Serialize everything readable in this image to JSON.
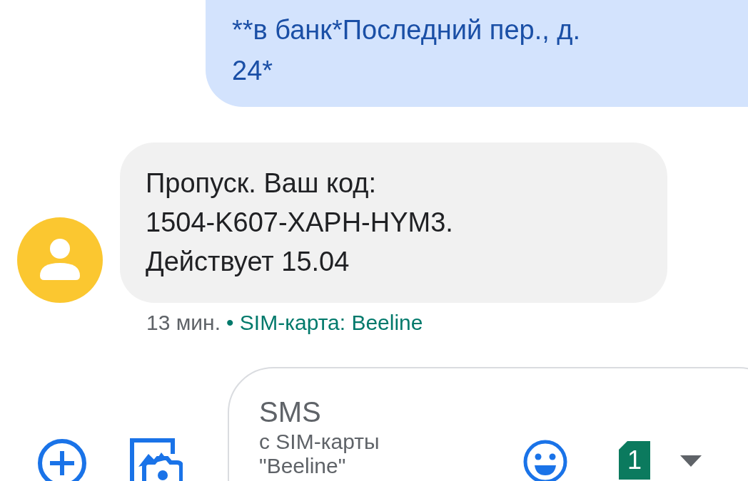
{
  "messages": [
    {
      "kind": "outgoing",
      "lines": [
        "**в банк*Последний пер., д.",
        "24*"
      ]
    },
    {
      "kind": "incoming",
      "lines": [
        "Пропуск. Ваш код:",
        "1504-K607-XAPH-HYM3.",
        "Действует 15.04"
      ],
      "time": "13 мин.",
      "sim": "• SIM-карта: Beeline"
    }
  ],
  "compose": {
    "hint_lines": [
      "SMS",
      "с SIM-карты",
      "\"Beeline\""
    ],
    "sim_slot": "1"
  }
}
